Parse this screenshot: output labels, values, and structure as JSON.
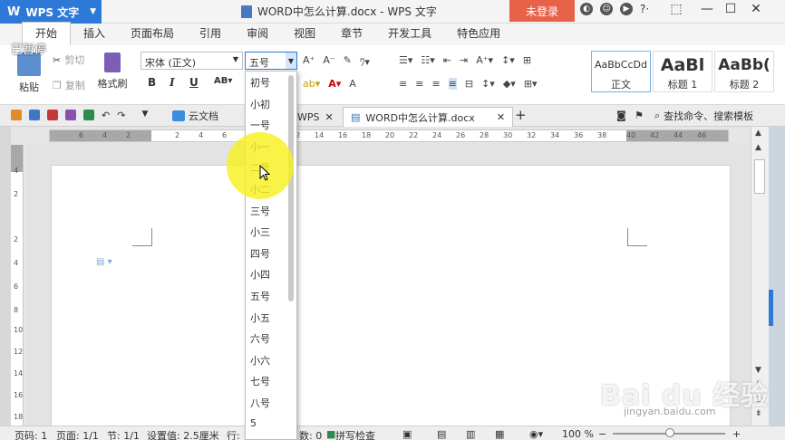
{
  "titlebar": {
    "app_label": "WPS 文字",
    "doc_title": "WORD中怎么计算.docx - WPS 文字",
    "login_label": "未登录"
  },
  "overlay": {
    "paused_label": "已暂停"
  },
  "tabs": [
    {
      "label": "开始",
      "active": true
    },
    {
      "label": "插入"
    },
    {
      "label": "页面布局"
    },
    {
      "label": "引用"
    },
    {
      "label": "审阅"
    },
    {
      "label": "视图"
    },
    {
      "label": "章节"
    },
    {
      "label": "开发工具"
    },
    {
      "label": "特色应用"
    }
  ],
  "ribbon": {
    "paste_label": "粘贴",
    "cut_label": "剪切",
    "copy_label": "复制",
    "format_painter_label": "格式刷",
    "font_name": "宋体 (正文)",
    "font_size": "五号",
    "styles": [
      {
        "sample": "AaBbCcDd",
        "name": "正文"
      },
      {
        "sample": "AaBl",
        "name": "标题 1"
      },
      {
        "sample": "AaBb(",
        "name": "标题 2"
      }
    ]
  },
  "toolbar2": {
    "cloud_label": "云文档",
    "tab_wps_label": "WPS",
    "tab_doc_label": "WORD中怎么计算.docx",
    "find_label": "查找命令、搜索模板"
  },
  "ruler_numbers": [
    "6",
    "4",
    "2",
    "2",
    "4",
    "6",
    "8",
    "10",
    "12",
    "14",
    "16",
    "18",
    "20",
    "22",
    "24",
    "26",
    "28",
    "30",
    "32",
    "34",
    "36",
    "38",
    "40",
    "42",
    "44",
    "46"
  ],
  "vruler_numbers": [
    "4",
    "2",
    "2",
    "4",
    "6",
    "8",
    "10",
    "12",
    "14",
    "16",
    "18"
  ],
  "font_size_options": [
    "初号",
    "小初",
    "一号",
    "小一",
    "二号",
    "小二",
    "三号",
    "小三",
    "四号",
    "小四",
    "五号",
    "小五",
    "六号",
    "小六",
    "七号",
    "八号",
    "5"
  ],
  "status": {
    "page": "页码: 1",
    "pages": "页面: 1/1",
    "section": "节: 1/1",
    "setting": "设置值: 2.5厘米",
    "row": "行:",
    "words": "数: 0",
    "spell": "拼写检查",
    "zoom": "100 %"
  },
  "watermark": {
    "brand": "Bai du 经验",
    "url": "jingyan.baidu.com"
  }
}
